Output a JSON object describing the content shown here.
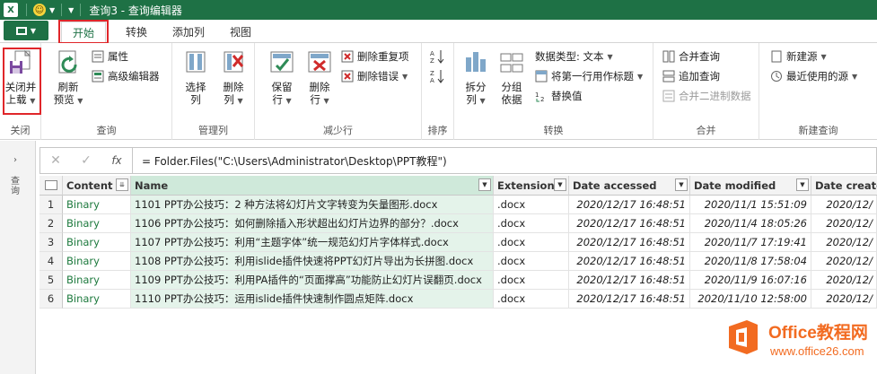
{
  "titlebar": {
    "app_icon": "X",
    "title": "查询3 - 查询编辑器"
  },
  "tabs": [
    {
      "label": "开始",
      "active": true
    },
    {
      "label": "转换"
    },
    {
      "label": "添加列"
    },
    {
      "label": "视图"
    }
  ],
  "ribbon": {
    "close": {
      "btn1": "关闭并",
      "btn2": "上载",
      "group": "关闭"
    },
    "query": {
      "refresh1": "刷新",
      "refresh2": "预览",
      "properties": "属性",
      "advanced": "高级编辑器",
      "group": "查询"
    },
    "manage_cols": {
      "select1": "选择",
      "select2": "列",
      "remove1": "删除",
      "remove2": "列",
      "group": "管理列"
    },
    "reduce_rows": {
      "keep1": "保留",
      "keep2": "行",
      "delete1": "删除",
      "delete2": "行",
      "remove_dup": "删除重复项",
      "remove_err": "删除错误",
      "group": "减少行"
    },
    "sort": {
      "group": "排序"
    },
    "transform": {
      "split1": "拆分",
      "split2": "列",
      "group1": "分组",
      "group2": "依据",
      "datatype": "数据类型: 文本",
      "first_row": "将第一行用作标题",
      "replace": "替换值",
      "group": "转换"
    },
    "combine": {
      "merge": "合并查询",
      "append": "追加查询",
      "merge_bin": "合并二进制数据",
      "group": "合并"
    },
    "new_query": {
      "new_source": "新建源",
      "recent": "最近使用的源",
      "group": "新建查询"
    }
  },
  "left_panel": {
    "vertical_label": "查询"
  },
  "formula": {
    "fx": "fx",
    "text": "= Folder.Files(\"C:\\Users\\Administrator\\Desktop\\PPT教程\")"
  },
  "table": {
    "columns": [
      "Content",
      "Name",
      "Extension",
      "Date accessed",
      "Date modified",
      "Date created"
    ],
    "rows": [
      {
        "n": "1",
        "content": "Binary",
        "name": "1101    PPT办公技巧：2 种方法将幻灯片文字转变为矢量图形.docx",
        "ext": ".docx",
        "acc": "2020/12/17 16:48:51",
        "mod": "2020/11/1 15:51:09",
        "cre": "2020/12/"
      },
      {
        "n": "2",
        "content": "Binary",
        "name": "1106    PPT办公技巧：如何删除插入形状超出幻灯片边界的部分？.docx",
        "ext": ".docx",
        "acc": "2020/12/17 16:48:51",
        "mod": "2020/11/4 18:05:26",
        "cre": "2020/12/"
      },
      {
        "n": "3",
        "content": "Binary",
        "name": "1107    PPT办公技巧：利用“主题字体”统一规范幻灯片字体样式.docx",
        "ext": ".docx",
        "acc": "2020/12/17 16:48:51",
        "mod": "2020/11/7 17:19:41",
        "cre": "2020/12/"
      },
      {
        "n": "4",
        "content": "Binary",
        "name": "1108    PPT办公技巧：利用islide插件快速将PPT幻灯片导出为长拼图.docx",
        "ext": ".docx",
        "acc": "2020/12/17 16:48:51",
        "mod": "2020/11/8 17:58:04",
        "cre": "2020/12/"
      },
      {
        "n": "5",
        "content": "Binary",
        "name": "1109    PPT办公技巧：利用PA插件的“页面撑高”功能防止幻灯片误翻页.docx",
        "ext": ".docx",
        "acc": "2020/12/17 16:48:51",
        "mod": "2020/11/9 16:07:16",
        "cre": "2020/12/"
      },
      {
        "n": "6",
        "content": "Binary",
        "name": "1110    PPT办公技巧：运用islide插件快速制作圆点矩阵.docx",
        "ext": ".docx",
        "acc": "2020/12/17 16:48:51",
        "mod": "2020/11/10 12:58:00",
        "cre": "2020/12/"
      }
    ]
  },
  "watermark": {
    "brand": "Office教程网",
    "url": "www.office26.com"
  },
  "colors": {
    "excel_green": "#1e7145",
    "highlight_red": "#e0262a",
    "binary_text": "#1e7a3e",
    "selected_col": "#e4f3ea",
    "watermark": "#f26b21"
  }
}
